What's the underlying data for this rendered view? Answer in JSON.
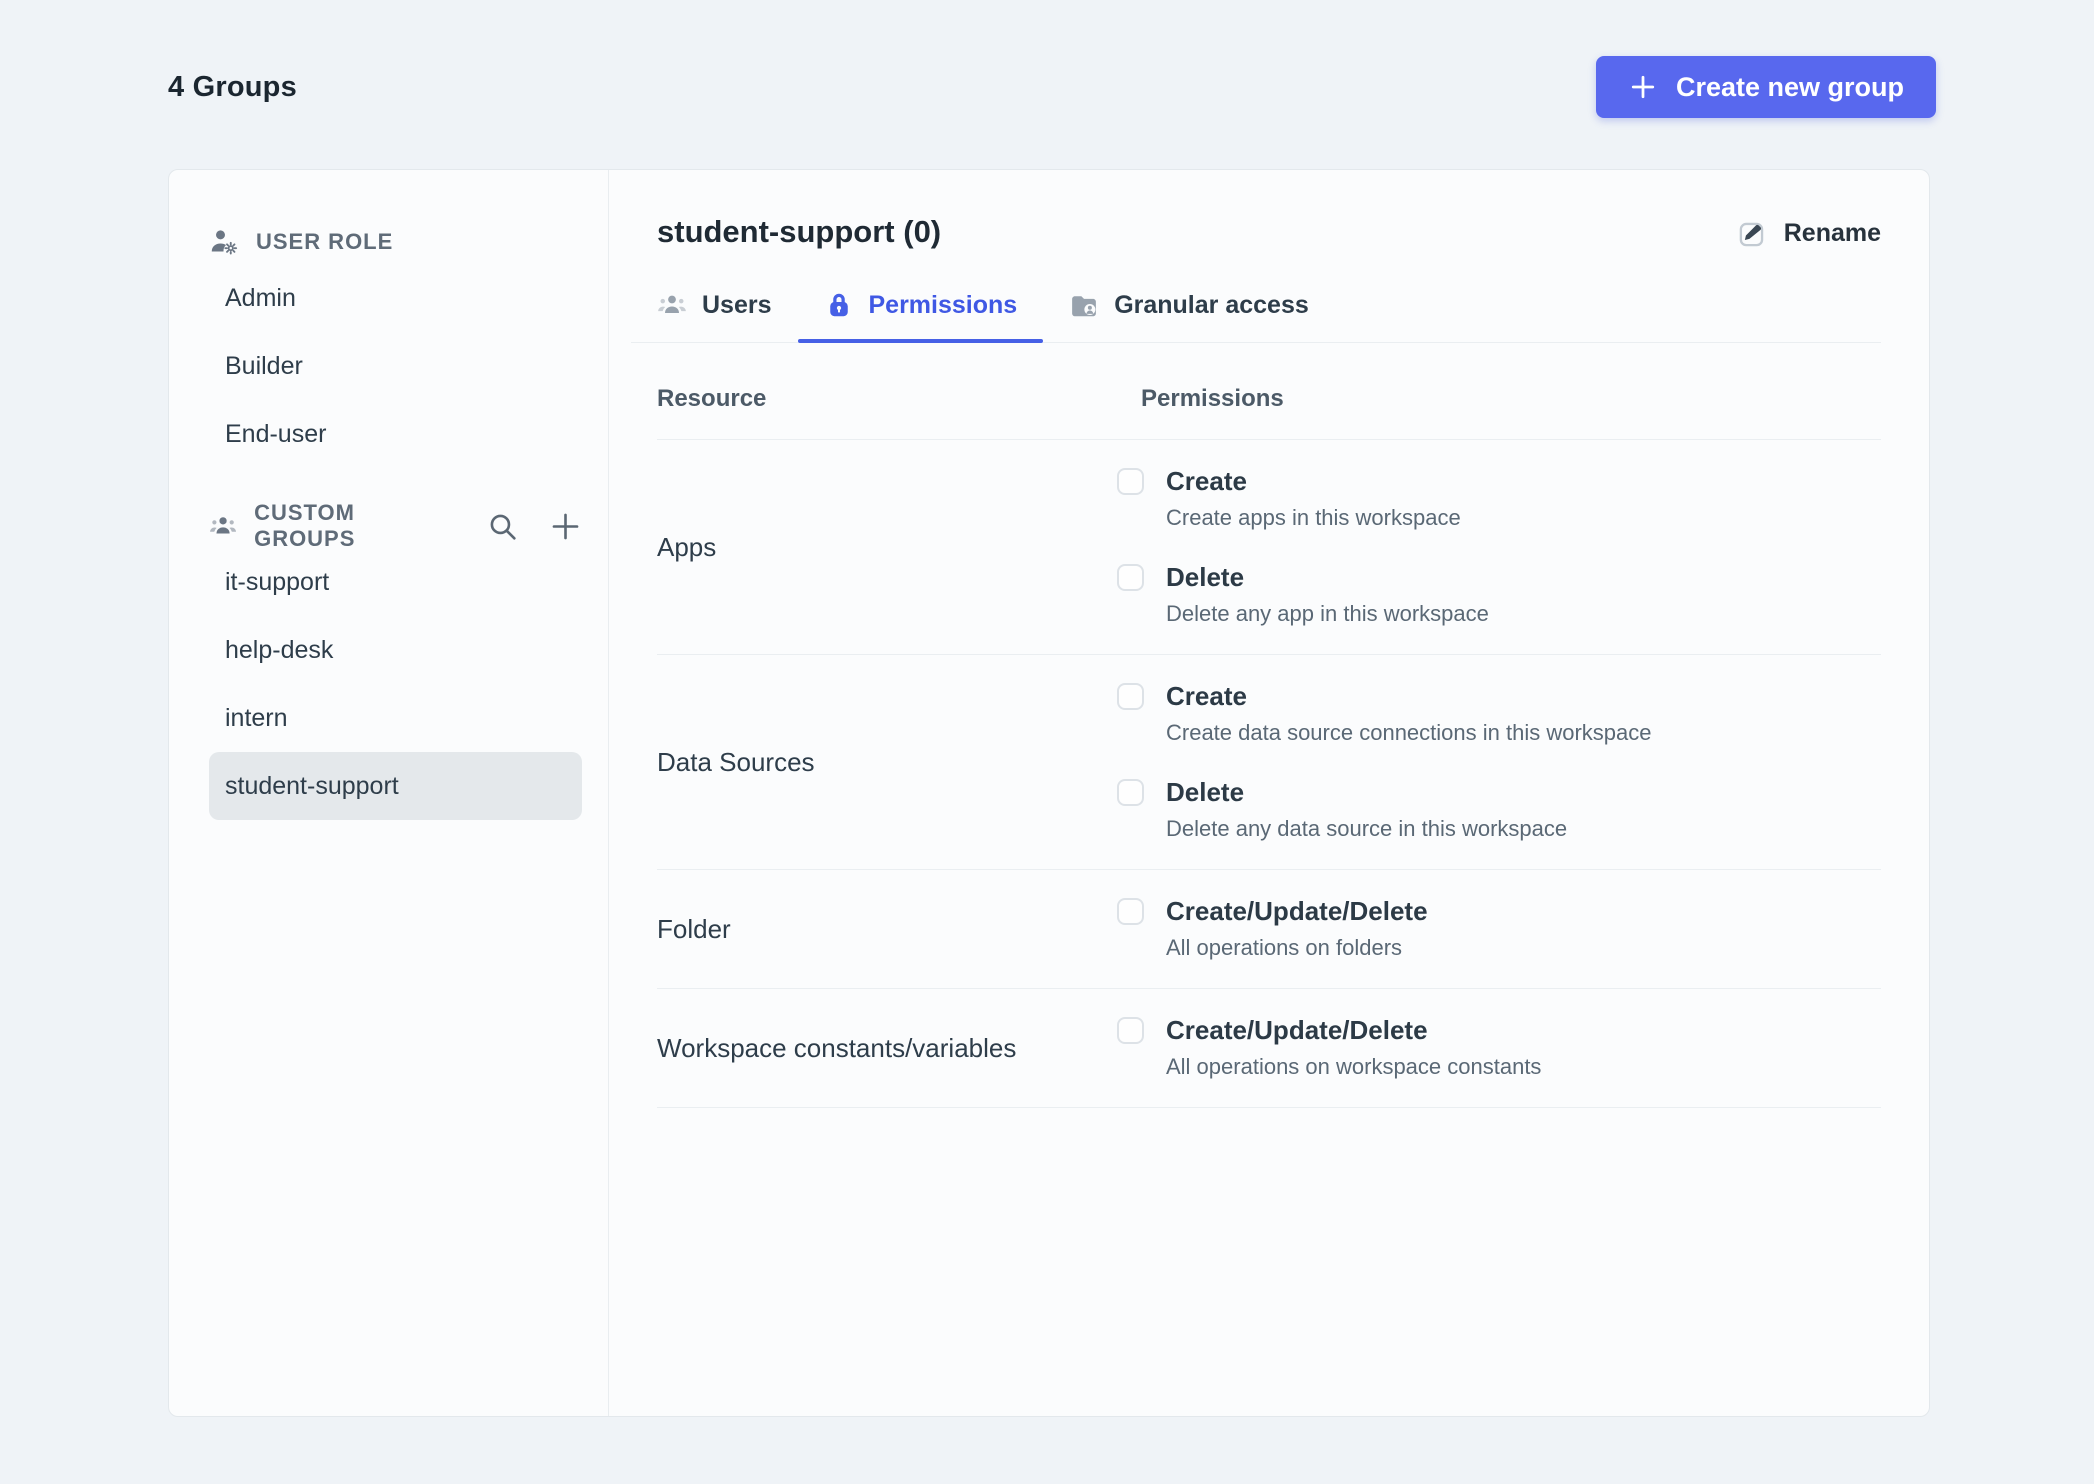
{
  "page": {
    "title": "4 Groups"
  },
  "header": {
    "create_button": {
      "label": "Create new group",
      "icon": "plus-icon"
    }
  },
  "colors": {
    "page_background": "#eff3f7",
    "card_background": "#fbfcfd",
    "accent_blue": "#4660e6",
    "button_blue": "#5868ee",
    "selected_item_background": "#e4e8eb",
    "divider": "#eaeef1",
    "text_primary": "#2e3d4a",
    "text_secondary": "#5f6b78"
  },
  "sidebar": {
    "sections": [
      {
        "title": "USER ROLE",
        "icon": "user-role-icon",
        "items": [
          {
            "label": "Admin",
            "selected": false
          },
          {
            "label": "Builder",
            "selected": false
          },
          {
            "label": "End-user",
            "selected": false
          }
        ]
      },
      {
        "title": "CUSTOM GROUPS",
        "icon": "custom-groups-icon",
        "actions": [
          "search-icon",
          "plus-icon"
        ],
        "items": [
          {
            "label": "it-support",
            "selected": false
          },
          {
            "label": "help-desk",
            "selected": false
          },
          {
            "label": "intern",
            "selected": false
          },
          {
            "label": "student-support",
            "selected": true
          }
        ]
      }
    ]
  },
  "panel": {
    "title": "student-support (0)",
    "rename": {
      "label": "Rename",
      "icon": "edit-icon"
    },
    "tabs": [
      {
        "label": "Users",
        "icon": "users-icon",
        "active": false
      },
      {
        "label": "Permissions",
        "icon": "lock-icon",
        "active": true
      },
      {
        "label": "Granular access",
        "icon": "folder-user-icon",
        "active": false
      }
    ],
    "table": {
      "columns": [
        "Resource",
        "Permissions"
      ],
      "rows": [
        {
          "resource": "Apps",
          "permissions": [
            {
              "label": "Create",
              "description": "Create apps in this workspace",
              "checked": false
            },
            {
              "label": "Delete",
              "description": "Delete any app in this workspace",
              "checked": false
            }
          ]
        },
        {
          "resource": "Data Sources",
          "permissions": [
            {
              "label": "Create",
              "description": "Create data source connections in this workspace",
              "checked": false
            },
            {
              "label": "Delete",
              "description": "Delete any data source in this workspace",
              "checked": false
            }
          ]
        },
        {
          "resource": "Folder",
          "permissions": [
            {
              "label": "Create/Update/Delete",
              "description": "All operations on folders",
              "checked": false
            }
          ]
        },
        {
          "resource": "Workspace constants/variables",
          "permissions": [
            {
              "label": "Create/Update/Delete",
              "description": "All operations on workspace constants",
              "checked": false
            }
          ]
        }
      ]
    }
  }
}
